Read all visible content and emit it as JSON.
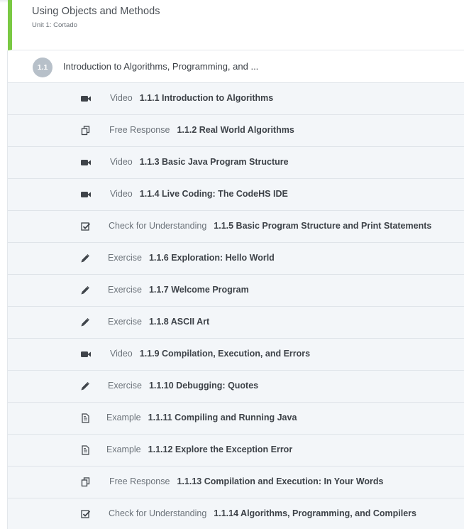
{
  "unit": {
    "title": "Using Objects and Methods",
    "subtitle": "Unit 1: Cortado",
    "accent_color": "#7ac943"
  },
  "lesson": {
    "badge": "1.1",
    "title": "Introduction to Algorithms, Programming, and ..."
  },
  "items": [
    {
      "type": "Video",
      "name": "1.1.1 Introduction to Algorithms",
      "icon": "video-camera-icon"
    },
    {
      "type": "Free Response",
      "name": "1.1.2 Real World Algorithms",
      "icon": "copy-icon"
    },
    {
      "type": "Video",
      "name": "1.1.3 Basic Java Program Structure",
      "icon": "video-camera-icon"
    },
    {
      "type": "Video",
      "name": "1.1.4 Live Coding: The CodeHS IDE",
      "icon": "video-camera-icon"
    },
    {
      "type": "Check for Understanding",
      "name": "1.1.5 Basic Program Structure and Print Statements",
      "icon": "check-square-icon"
    },
    {
      "type": "Exercise",
      "name": "1.1.6 Exploration: Hello World",
      "icon": "pencil-icon"
    },
    {
      "type": "Exercise",
      "name": "1.1.7 Welcome Program",
      "icon": "pencil-icon"
    },
    {
      "type": "Exercise",
      "name": "1.1.8 ASCII Art",
      "icon": "pencil-icon"
    },
    {
      "type": "Video",
      "name": "1.1.9 Compilation, Execution, and Errors",
      "icon": "video-camera-icon"
    },
    {
      "type": "Exercise",
      "name": "1.1.10 Debugging: Quotes",
      "icon": "pencil-icon"
    },
    {
      "type": "Example",
      "name": "1.1.11 Compiling and Running Java",
      "icon": "document-icon"
    },
    {
      "type": "Example",
      "name": "1.1.12 Explore the Exception Error",
      "icon": "document-icon"
    },
    {
      "type": "Free Response",
      "name": "1.1.13 Compilation and Execution: In Your Words",
      "icon": "copy-icon"
    },
    {
      "type": "Check for Understanding",
      "name": "1.1.14 Algorithms, Programming, and Compilers",
      "icon": "check-square-icon"
    }
  ]
}
